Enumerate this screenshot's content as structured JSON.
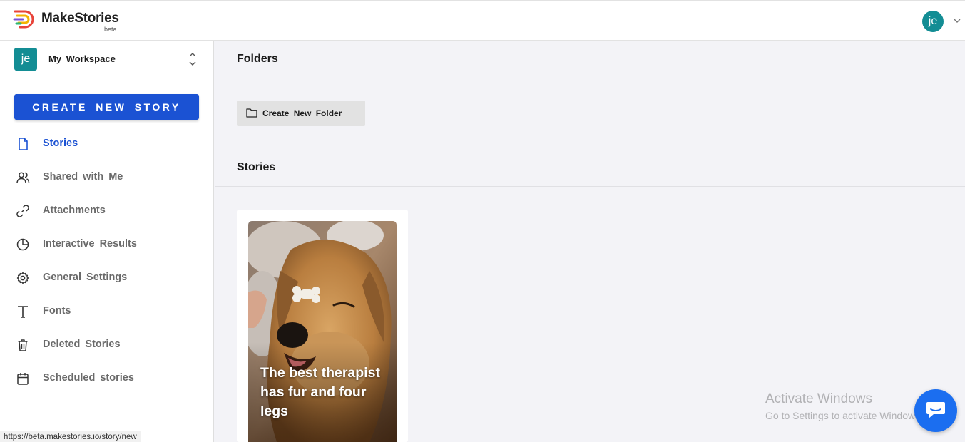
{
  "brand": {
    "name": "MakeStories",
    "tag": "beta"
  },
  "user": {
    "initials": "je"
  },
  "workspace": {
    "initials": "je",
    "name": "My Workspace"
  },
  "sidebar": {
    "create_label": "CREATE NEW STORY",
    "items": [
      {
        "label": "Stories",
        "icon": "file-icon",
        "active": true
      },
      {
        "label": "Shared with Me",
        "icon": "users-icon"
      },
      {
        "label": "Attachments",
        "icon": "link-icon"
      },
      {
        "label": "Interactive Results",
        "icon": "pie-chart-icon"
      },
      {
        "label": "General Settings",
        "icon": "gear-icon"
      },
      {
        "label": "Fonts",
        "icon": "type-icon"
      },
      {
        "label": "Deleted Stories",
        "icon": "trash-icon"
      },
      {
        "label": "Scheduled stories",
        "icon": "calendar-icon"
      }
    ]
  },
  "main": {
    "folders_title": "Folders",
    "create_folder_label": "Create New Folder",
    "stories_title": "Stories",
    "stories": [
      {
        "caption": "The best therapist has fur and four legs"
      }
    ]
  },
  "os_notice": {
    "title": "Activate Windows",
    "subtitle": "Go to Settings to activate Windows."
  },
  "status_bar": {
    "url": "https://beta.makestories.io/story/new"
  },
  "colors": {
    "accent": "#1b52d3",
    "avatar": "#138d94",
    "chat": "#1b6ef0"
  }
}
